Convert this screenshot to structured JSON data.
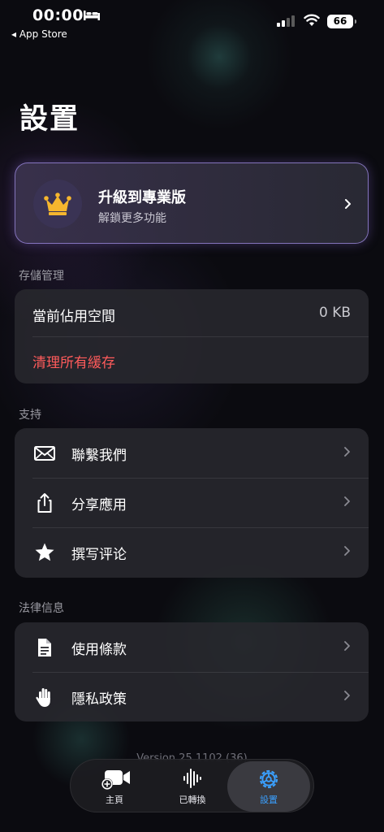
{
  "status": {
    "time": "00:00",
    "back_app": "◂ App Store",
    "battery": "66"
  },
  "page_title": "設置",
  "pro": {
    "title": "升級到專業版",
    "subtitle": "解鎖更多功能"
  },
  "storage": {
    "section": "存儲管理",
    "usage_label": "當前佔用空間",
    "usage_value": "0 KB",
    "clear_label": "清理所有緩存"
  },
  "support": {
    "section": "支持",
    "items": [
      {
        "label": "聯繫我們",
        "icon": "mail-icon"
      },
      {
        "label": "分享應用",
        "icon": "share-icon"
      },
      {
        "label": "撰写评论",
        "icon": "star-icon"
      }
    ]
  },
  "legal": {
    "section": "法律信息",
    "items": [
      {
        "label": "使用條款",
        "icon": "document-icon"
      },
      {
        "label": "隱私政策",
        "icon": "hand-icon"
      }
    ]
  },
  "version": "Version 25.1102 (36)",
  "tabs": [
    {
      "label": "主頁",
      "icon": "video-add-icon"
    },
    {
      "label": "已轉換",
      "icon": "waveform-icon"
    },
    {
      "label": "設置",
      "icon": "gear-icon",
      "active": true
    }
  ],
  "colors": {
    "accent": "#3aa0ff",
    "danger": "#ff5b5b",
    "crown": "#f5b62e"
  }
}
